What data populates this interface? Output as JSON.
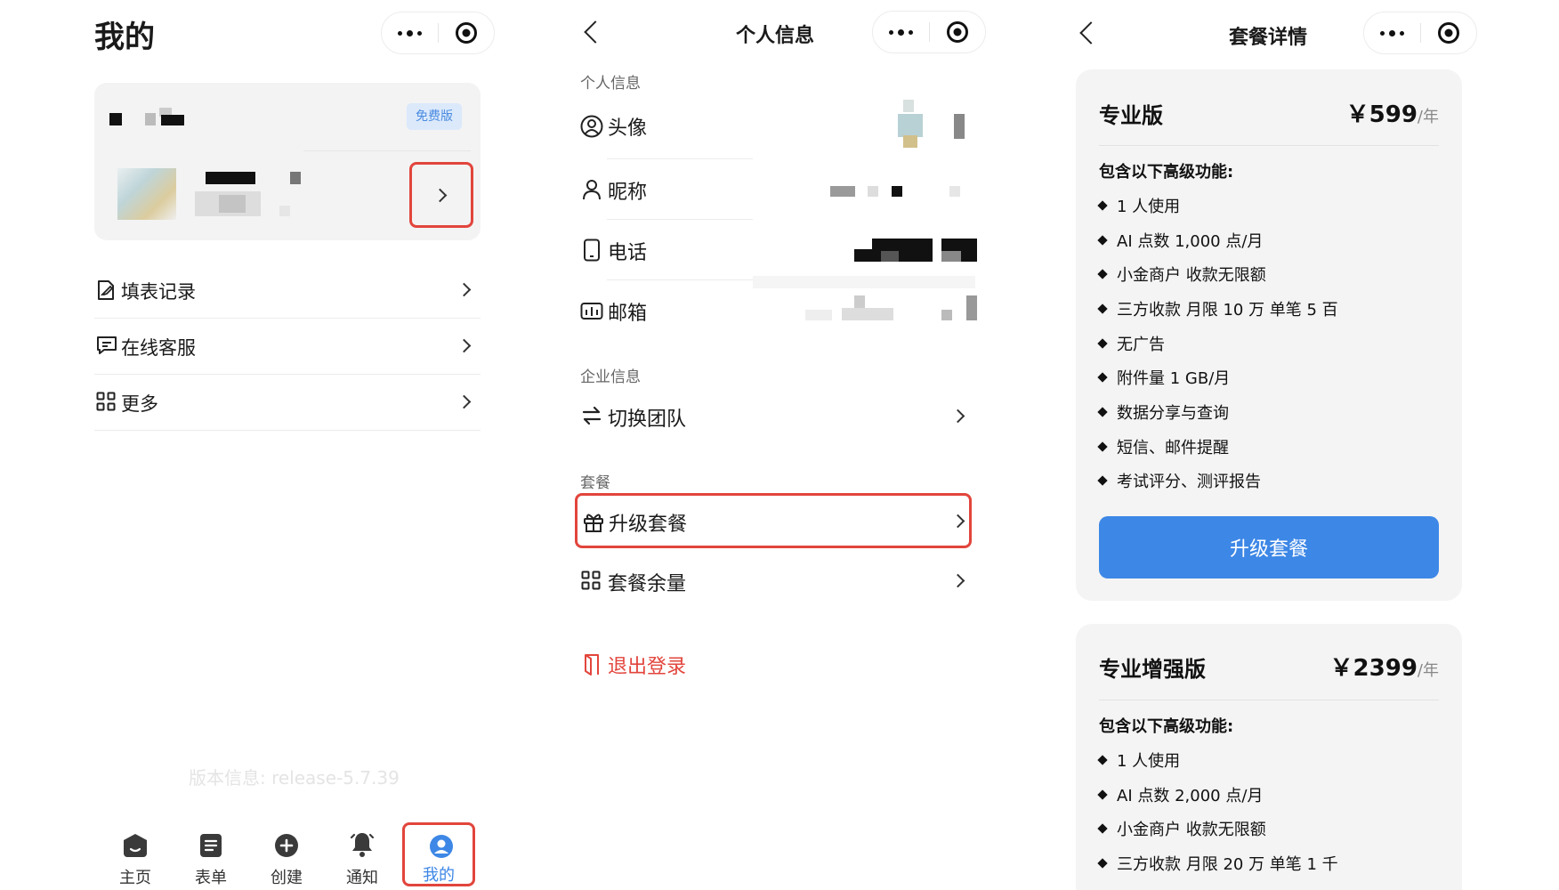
{
  "screen1": {
    "title": "我的",
    "badge": "免费版",
    "menu": [
      {
        "label": "填表记录",
        "icon": "form-record-icon"
      },
      {
        "label": "在线客服",
        "icon": "chat-icon"
      },
      {
        "label": "更多",
        "icon": "grid-icon"
      }
    ],
    "version": "版本信息: release-5.7.39",
    "tabs": [
      {
        "label": "主页",
        "icon": "home-icon"
      },
      {
        "label": "表单",
        "icon": "form-icon"
      },
      {
        "label": "创建",
        "icon": "plus-icon"
      },
      {
        "label": "通知",
        "icon": "bell-icon"
      },
      {
        "label": "我的",
        "icon": "user-icon"
      }
    ]
  },
  "screen2": {
    "title": "个人信息",
    "section_personal": "个人信息",
    "personal_rows": [
      {
        "label": "头像",
        "icon": "avatar-icon"
      },
      {
        "label": "昵称",
        "icon": "person-icon"
      },
      {
        "label": "电话",
        "icon": "phone-icon"
      },
      {
        "label": "邮箱",
        "icon": "mail-icon"
      }
    ],
    "section_company": "企业信息",
    "switch_team": "切换团队",
    "section_plan": "套餐",
    "upgrade": "升级套餐",
    "plan_quota": "套餐余量",
    "logout": "退出登录"
  },
  "screen3": {
    "title": "套餐详情",
    "plans": [
      {
        "name": "专业版",
        "price": "￥599",
        "unit": "/年",
        "features_title": "包含以下高级功能:",
        "features": [
          "1 人使用",
          "AI 点数 1,000 点/月",
          "小金商户 收款无限额",
          "三方收款 月限 10 万 单笔 5 百",
          "无广告",
          "附件量 1 GB/月",
          "数据分享与查询",
          "短信、邮件提醒",
          "考试评分、测评报告"
        ],
        "button": "升级套餐"
      },
      {
        "name": "专业增强版",
        "price": "￥2399",
        "unit": "/年",
        "features_title": "包含以下高级功能:",
        "features": [
          "1 人使用",
          "AI 点数 2,000 点/月",
          "小金商户 收款无限额",
          "三方收款 月限 20 万 单笔 1 千"
        ]
      }
    ]
  },
  "colors": {
    "accent": "#3d87e6",
    "highlight": "#e2453c",
    "logout": "#e2453c"
  }
}
